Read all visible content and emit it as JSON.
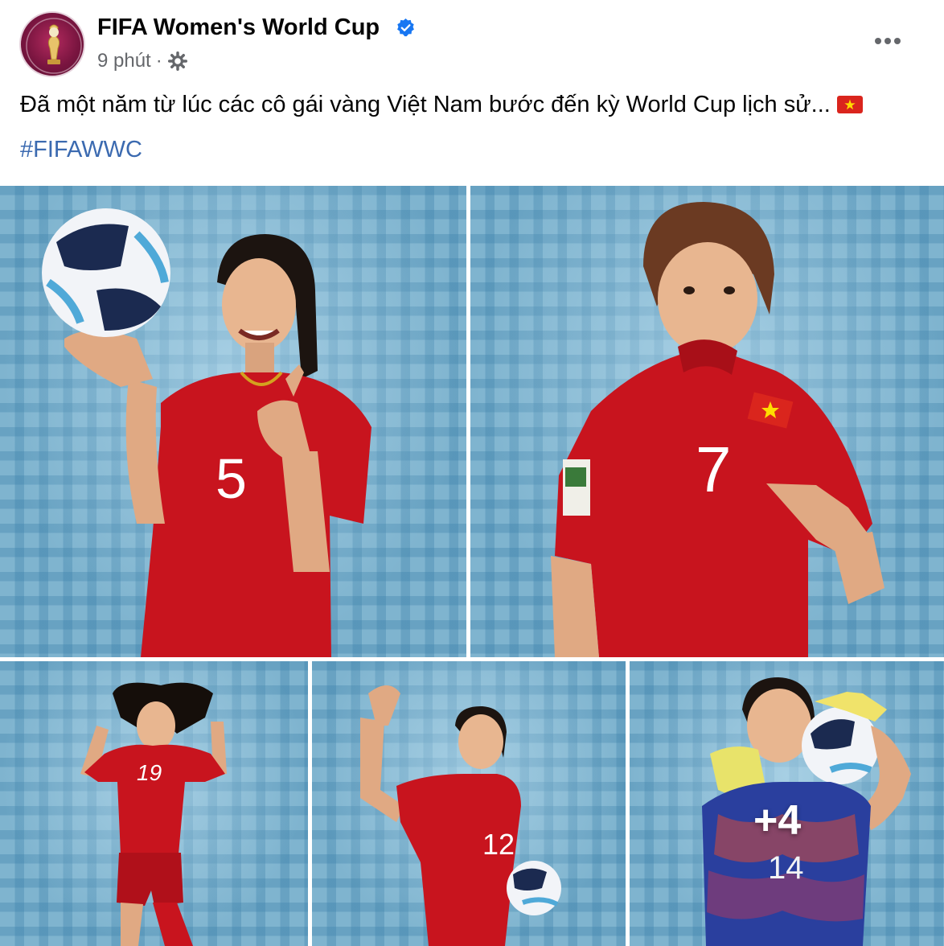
{
  "post": {
    "page_name": "FIFA Women's World Cup",
    "time": "9 phút",
    "separator": "·",
    "privacy_icon": "gear-globe-icon",
    "verified_icon": "verified-badge-icon",
    "more_icon": "more-horizontal-icon",
    "text": "Đã một năm từ lúc các cô gái vàng Việt Nam bước đến kỳ World Cup lịch sử...",
    "flag_icon": "vietnam-flag-icon",
    "hashtag": "#FIFAWWC"
  },
  "photos": {
    "more_count": "+4",
    "items": [
      {
        "jersey_number": "5",
        "description": "player-holding-ball-pointing"
      },
      {
        "jersey_number": "7",
        "description": "player-biting-jersey"
      },
      {
        "jersey_number": "19",
        "description": "player-jumping-hair-up"
      },
      {
        "jersey_number": "12",
        "description": "player-flexing-with-ball"
      },
      {
        "jersey_number": "14",
        "description": "goalkeeper-with-ball"
      }
    ]
  },
  "colors": {
    "link": "#3b6ab0",
    "verified": "#1877f2",
    "jersey_red": "#c8141e",
    "backdrop": "#7fb4cf",
    "keeper_blue": "#2a3f9e"
  }
}
